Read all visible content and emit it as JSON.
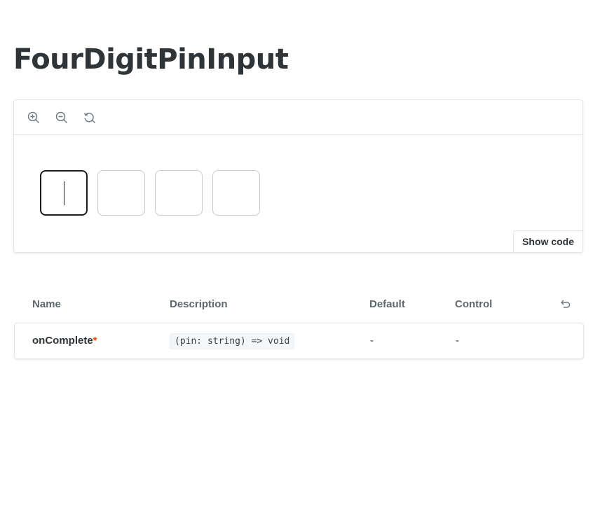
{
  "page": {
    "title": "FourDigitPinInput"
  },
  "toolbar": {
    "icons": [
      "zoom-in-icon",
      "zoom-out-icon",
      "reset-zoom-icon"
    ]
  },
  "preview": {
    "pin_boxes": [
      "",
      "",
      "",
      ""
    ],
    "active_index": 0,
    "show_code_label": "Show code"
  },
  "props_table": {
    "headers": {
      "name": "Name",
      "description": "Description",
      "default": "Default",
      "control": "Control"
    },
    "rows": [
      {
        "name": "onComplete",
        "required_mark": "*",
        "type": "(pin: string) => void",
        "default": "-",
        "control": "-"
      }
    ]
  },
  "colors": {
    "accent_required": "#ff4400",
    "border": "#e3e6e8",
    "text": "#2e3438"
  }
}
